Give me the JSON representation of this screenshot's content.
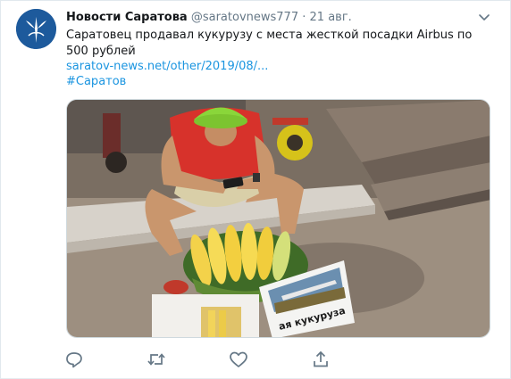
{
  "account": {
    "name": "Новости Саратова",
    "handle": "@saratovnews777",
    "dot": "·",
    "date": "21 авг."
  },
  "tweet": {
    "text": "Саратовец продавал кукурузу с места жесткой посадки Airbus по 500 рублей",
    "link": "saratov-news.net/other/2019/08/...",
    "hashtag": "#Саратов"
  },
  "media": {
    "sign_text": "ая кукуруза"
  },
  "icons": {
    "more": "chevron-down-icon",
    "reply": "reply-icon",
    "retweet": "retweet-icon",
    "like": "heart-icon",
    "share": "share-icon"
  },
  "colors": {
    "accent": "#1b95e0",
    "avatar_bg": "#1d5a9c",
    "muted": "#657786"
  }
}
